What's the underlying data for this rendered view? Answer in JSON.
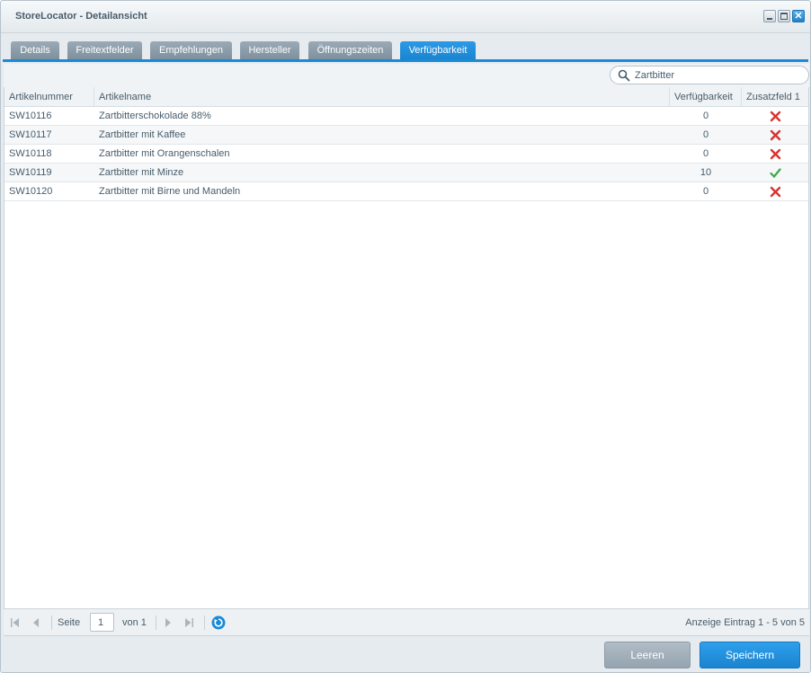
{
  "window": {
    "title": "StoreLocator - Detailansicht",
    "controls": [
      "minimize-icon",
      "maximize-icon",
      "close-icon"
    ],
    "close_glyph": "✕"
  },
  "tabs": [
    {
      "label": "Details",
      "active": false
    },
    {
      "label": "Freitextfelder",
      "active": false
    },
    {
      "label": "Empfehlungen",
      "active": false
    },
    {
      "label": "Hersteller",
      "active": false
    },
    {
      "label": "Öffnungszeiten",
      "active": false
    },
    {
      "label": "Verfügbarkeit",
      "active": true
    }
  ],
  "search": {
    "value": "Zartbitter",
    "placeholder": "",
    "icon": "search-icon"
  },
  "grid": {
    "columns": [
      "Artikelnummer",
      "Artikelname",
      "Verfügbarkeit",
      "Zusatzfeld 1"
    ],
    "rows": [
      {
        "number": "SW10116",
        "name": "Zartbitterschokolade 88%",
        "availability": "0",
        "extra": false
      },
      {
        "number": "SW10117",
        "name": "Zartbitter mit Kaffee",
        "availability": "0",
        "extra": false
      },
      {
        "number": "SW10118",
        "name": "Zartbitter mit Orangenschalen",
        "availability": "0",
        "extra": false
      },
      {
        "number": "SW10119",
        "name": "Zartbitter mit Minze",
        "availability": "10",
        "extra": true
      },
      {
        "number": "SW10120",
        "name": "Zartbitter mit Birne und Mandeln",
        "availability": "0",
        "extra": false
      }
    ]
  },
  "pager": {
    "page_label": "Seite",
    "page_value": "1",
    "of_label": "von 1",
    "info": "Anzeige Eintrag 1 - 5 von 5"
  },
  "footer": {
    "clear_label": "Leeren",
    "save_label": "Speichern"
  },
  "colors": {
    "accent": "#1a8ad8",
    "check": "#3aa844",
    "cross": "#d9332f"
  }
}
